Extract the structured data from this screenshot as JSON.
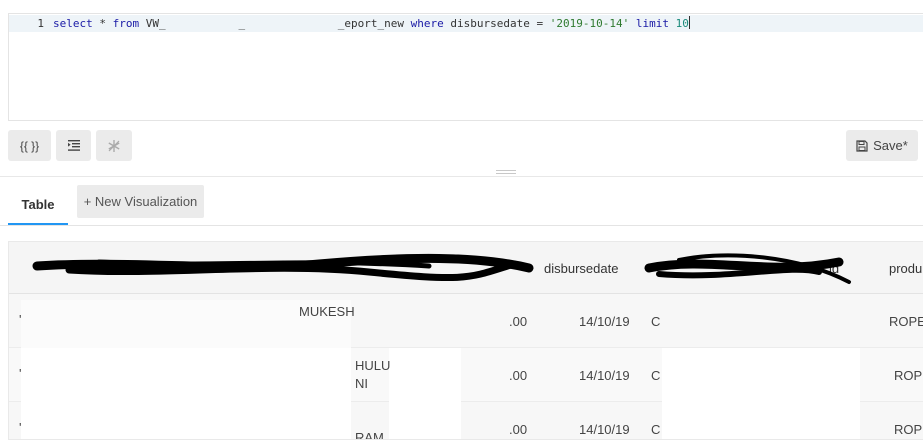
{
  "editor": {
    "line_number": "1",
    "query": {
      "select": "select",
      "star": " * ",
      "from": "from",
      "table": " VW_           _              _eport_new ",
      "where": "where",
      "column": " disbursedate = ",
      "date": "'2019-10-14'",
      "limit": " limit ",
      "limit_value": "10"
    }
  },
  "toolbar": {
    "format_label": "{{ }}",
    "save_label": "Save*"
  },
  "tabs": {
    "table": "Table",
    "new_visualization": "+ New Visualization"
  },
  "table": {
    "headers": {
      "disbursedate": "disbursedate",
      "id_fragment": "id",
      "product_fragment": "produ"
    },
    "rows": [
      {
        "c0": "'",
        "name": "MUKESH",
        "amount": ".00",
        "disbursedate": "14/10/19",
        "code": "C",
        "product": "ROPE"
      },
      {
        "c0": "'",
        "name_line1": "HULU",
        "name_line2": "NI",
        "amount": ".00",
        "disbursedate": "14/10/19",
        "code": "C",
        "product": "ROPE"
      },
      {
        "c0": "'",
        "name": "RAM",
        "amount": ".00",
        "disbursedate": "14/10/19",
        "code": "C",
        "product": "ROPE"
      }
    ]
  },
  "colors": {
    "accent": "#2196f3",
    "keyword": "#1a1aa6",
    "string": "#2f7a2f",
    "number": "#1a8a7a"
  }
}
